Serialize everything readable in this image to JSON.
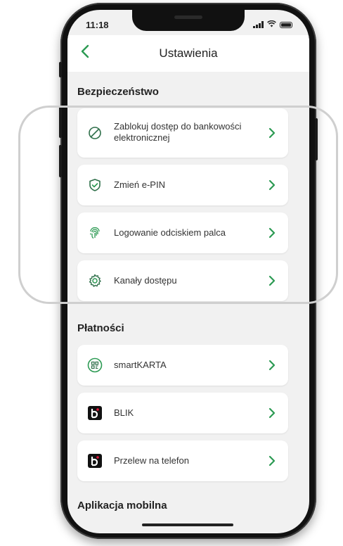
{
  "status": {
    "time": "11:18"
  },
  "header": {
    "title": "Ustawienia"
  },
  "sections": {
    "security": {
      "title": "Bezpieczeństwo",
      "items": [
        {
          "label_line1": "Zablokuj dostęp do bankowości",
          "label_line2": "elektronicznej",
          "icon": "block-icon"
        },
        {
          "label": "Zmień e-PIN",
          "icon": "shield-check-icon"
        },
        {
          "label": "Logowanie odciskiem palca",
          "icon": "fingerprint-icon"
        },
        {
          "label": "Kanały dostępu",
          "icon": "gear-icon"
        }
      ]
    },
    "payments": {
      "title": "Płatności",
      "items": [
        {
          "label": "smartKARTA",
          "icon": "smartkarta-icon"
        },
        {
          "label": "BLIK",
          "icon": "blik-icon"
        },
        {
          "label": "Przelew na telefon",
          "icon": "blik-icon"
        }
      ]
    },
    "mobile_app": {
      "title": "Aplikacja mobilna"
    }
  },
  "colors": {
    "accent": "#2c9a53",
    "screen_bg": "#f1f1f1"
  }
}
